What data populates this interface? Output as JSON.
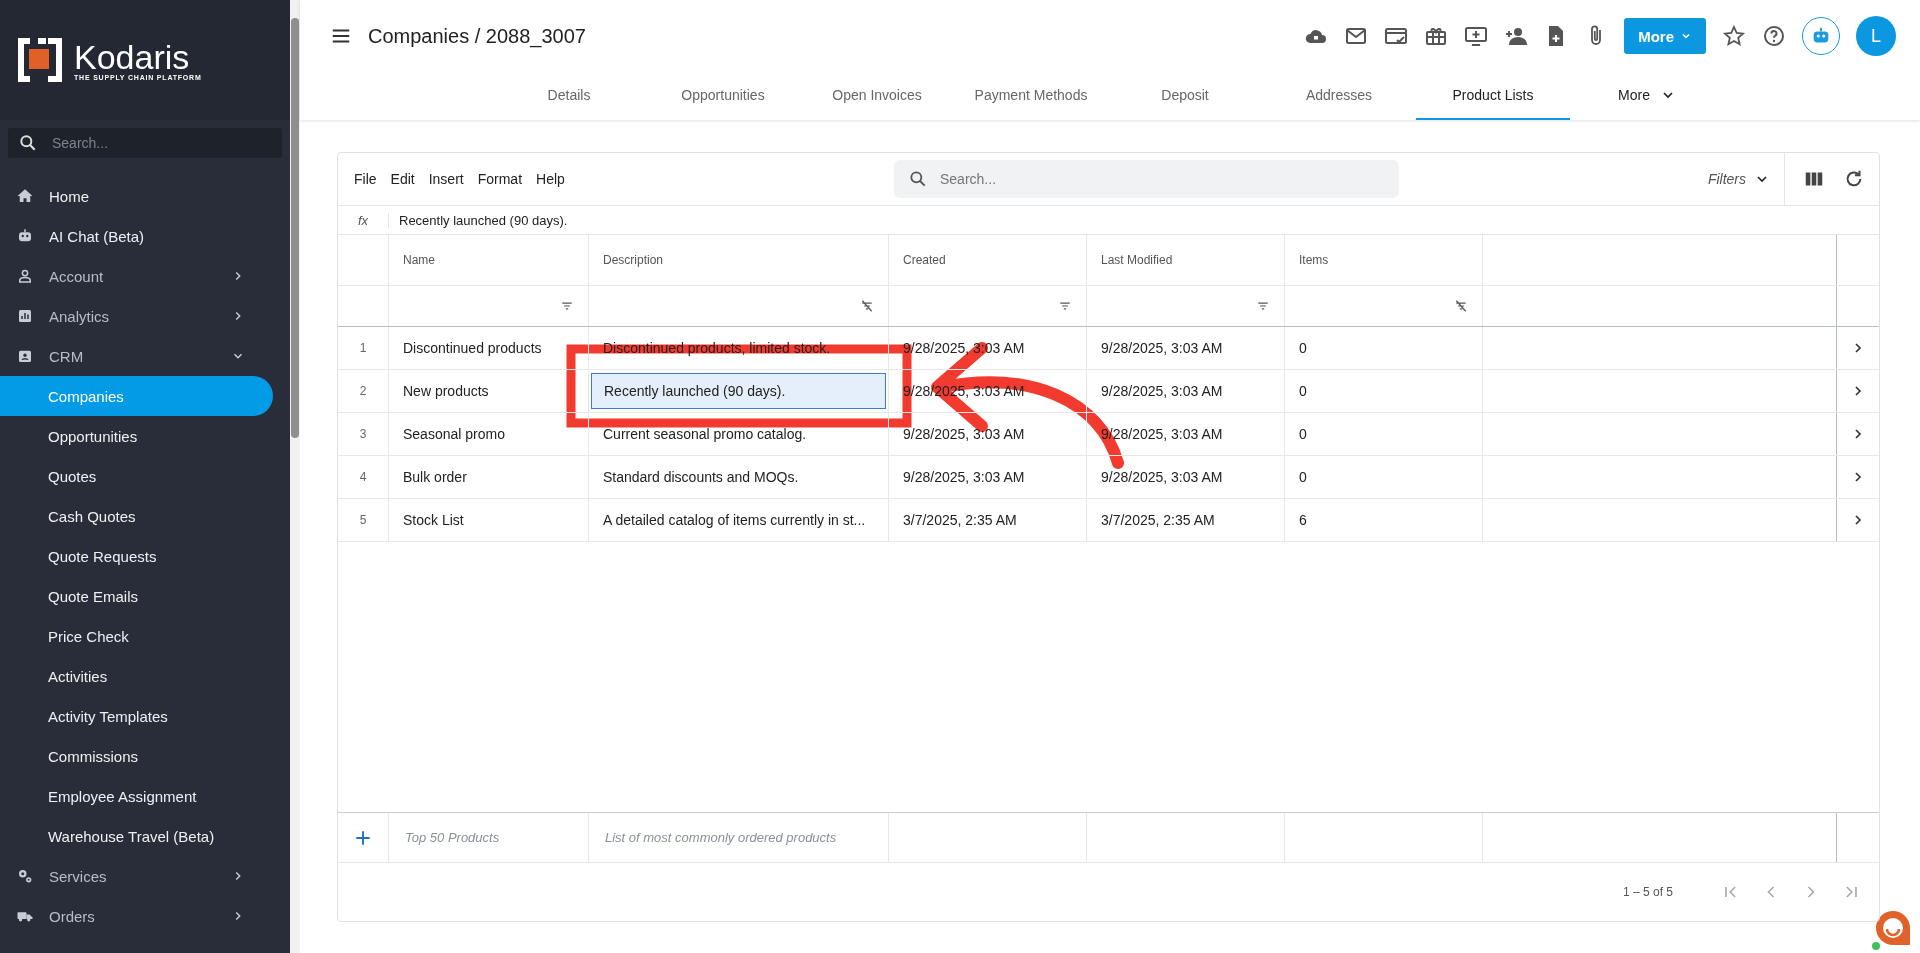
{
  "sidebar": {
    "logo": {
      "name": "Kodaris",
      "tagline": "THE SUPPLY CHAIN PLATFORM"
    },
    "search": {
      "placeholder": "Search..."
    },
    "items": [
      {
        "label": "Home",
        "kind": "link",
        "selected": false
      },
      {
        "label": "AI Chat (Beta)",
        "kind": "link",
        "selected": false
      },
      {
        "label": "Account",
        "kind": "group",
        "expanded": false,
        "selected": false
      },
      {
        "label": "Analytics",
        "kind": "group",
        "expanded": false,
        "selected": false
      },
      {
        "label": "CRM",
        "kind": "group",
        "expanded": true,
        "selected": false,
        "children": [
          {
            "label": "Companies",
            "selected": true
          },
          {
            "label": "Opportunities",
            "selected": false
          },
          {
            "label": "Quotes",
            "selected": false
          },
          {
            "label": "Cash Quotes",
            "selected": false
          },
          {
            "label": "Quote Requests",
            "selected": false
          },
          {
            "label": "Quote Emails",
            "selected": false
          },
          {
            "label": "Price Check",
            "selected": false
          },
          {
            "label": "Activities",
            "selected": false
          },
          {
            "label": "Activity Templates",
            "selected": false
          },
          {
            "label": "Commissions",
            "selected": false
          },
          {
            "label": "Employee Assignment",
            "selected": false
          },
          {
            "label": "Warehouse Travel (Beta)",
            "selected": false
          }
        ]
      },
      {
        "label": "Services",
        "kind": "group",
        "expanded": false,
        "selected": false
      },
      {
        "label": "Orders",
        "kind": "group",
        "expanded": false,
        "selected": false
      }
    ]
  },
  "header": {
    "breadcrumb": "Companies / 2088_3007",
    "more_button": "More",
    "avatar": "L"
  },
  "tabs": [
    {
      "label": "Details",
      "selected": false
    },
    {
      "label": "Opportunities",
      "selected": false
    },
    {
      "label": "Open Invoices",
      "selected": false
    },
    {
      "label": "Payment Methods",
      "selected": false
    },
    {
      "label": "Deposit",
      "selected": false
    },
    {
      "label": "Addresses",
      "selected": false
    },
    {
      "label": "Product Lists",
      "selected": true
    },
    {
      "label": "More",
      "selected": false,
      "kind": "menu"
    }
  ],
  "toolbar": {
    "menus": [
      "File",
      "Edit",
      "Insert",
      "Format",
      "Help"
    ],
    "search": {
      "placeholder": "Search..."
    },
    "filters": "Filters"
  },
  "formula_bar": {
    "label": "fx",
    "value": "Recently launched (90 days)."
  },
  "table": {
    "columns": [
      {
        "label": "Name",
        "kind": "lines"
      },
      {
        "label": "Description",
        "kind": "crossed"
      },
      {
        "label": "Created",
        "kind": "lines"
      },
      {
        "label": "Last Modified",
        "kind": "lines"
      },
      {
        "label": "Items",
        "kind": "crossed"
      }
    ],
    "rows": [
      {
        "number": "1",
        "name": "Discontinued products",
        "description": "Discontinued products, limited stock.",
        "created": "9/28/2025, 3:03 AM",
        "modified": "9/28/2025, 3:03 AM",
        "items": "0",
        "selected": false
      },
      {
        "number": "2",
        "name": "New products",
        "description": "Recently launched (90 days).",
        "created": "9/28/2025, 3:03 AM",
        "modified": "9/28/2025, 3:03 AM",
        "items": "0",
        "selected": true
      },
      {
        "number": "3",
        "name": "Seasonal promo",
        "description": "Current seasonal promo catalog.",
        "created": "9/28/2025, 3:03 AM",
        "modified": "9/28/2025, 3:03 AM",
        "items": "0",
        "selected": false
      },
      {
        "number": "4",
        "name": "Bulk order",
        "description": "Standard discounts and MOQs.",
        "created": "9/28/2025, 3:03 AM",
        "modified": "9/28/2025, 3:03 AM",
        "items": "0",
        "selected": false
      },
      {
        "number": "5",
        "name": "Stock List",
        "description": "A detailed catalog of items currently in st...",
        "created": "3/7/2025, 2:35 AM",
        "modified": "3/7/2025, 2:35 AM",
        "items": "6",
        "selected": false
      }
    ],
    "new_row": {
      "name": {
        "placeholder": "Top 50 Products"
      },
      "description": {
        "placeholder": "List of most commonly ordered products"
      }
    }
  },
  "pagination": {
    "range": "1 – 5 of 5"
  },
  "annotations": {
    "highlight_box": true,
    "arrow": true
  }
}
